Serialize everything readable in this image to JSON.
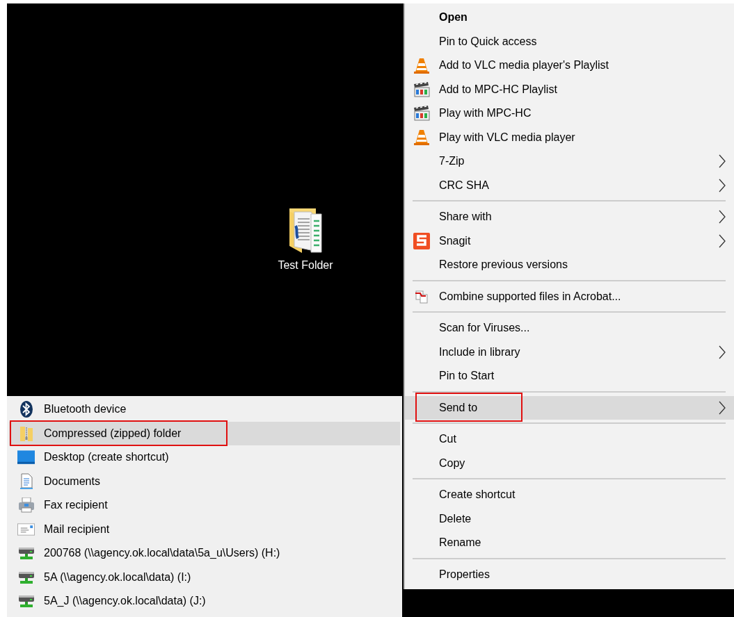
{
  "desktop": {
    "icons": [
      {
        "label": "Test Folder",
        "kind": "folder"
      }
    ]
  },
  "context_menu": {
    "groups": [
      {
        "items": [
          {
            "label": "Open",
            "kind": "plain",
            "default": true,
            "submenu": false,
            "selected": false,
            "outlined": false
          },
          {
            "label": "Pin to Quick access",
            "kind": "plain",
            "default": false,
            "submenu": false,
            "selected": false,
            "outlined": false
          },
          {
            "label": "Add to VLC media player's Playlist",
            "kind": "cone",
            "default": false,
            "submenu": false,
            "selected": false,
            "outlined": false
          },
          {
            "label": "Add to MPC-HC Playlist",
            "kind": "clapper",
            "default": false,
            "submenu": false,
            "selected": false,
            "outlined": false
          },
          {
            "label": "Play with MPC-HC",
            "kind": "clapper",
            "default": false,
            "submenu": false,
            "selected": false,
            "outlined": false
          },
          {
            "label": "Play with VLC media player",
            "kind": "cone",
            "default": false,
            "submenu": false,
            "selected": false,
            "outlined": false
          },
          {
            "label": "7-Zip",
            "kind": "plain",
            "default": false,
            "submenu": true,
            "selected": false,
            "outlined": false
          },
          {
            "label": "CRC SHA",
            "kind": "plain",
            "default": false,
            "submenu": true,
            "selected": false,
            "outlined": false
          }
        ]
      },
      {
        "items": [
          {
            "label": "Share with",
            "kind": "plain",
            "default": false,
            "submenu": true,
            "selected": false,
            "outlined": false
          },
          {
            "label": "Snagit",
            "kind": "snagit",
            "default": false,
            "submenu": true,
            "selected": false,
            "outlined": false
          },
          {
            "label": "Restore previous versions",
            "kind": "plain",
            "default": false,
            "submenu": false,
            "selected": false,
            "outlined": false
          }
        ]
      },
      {
        "items": [
          {
            "label": "Combine supported files in Acrobat...",
            "kind": "acrobat",
            "default": false,
            "submenu": false,
            "selected": false,
            "outlined": false
          }
        ]
      },
      {
        "items": [
          {
            "label": "Scan for Viruses...",
            "kind": "plain",
            "default": false,
            "submenu": false,
            "selected": false,
            "outlined": false
          },
          {
            "label": "Include in library",
            "kind": "plain",
            "default": false,
            "submenu": true,
            "selected": false,
            "outlined": false
          },
          {
            "label": "Pin to Start",
            "kind": "plain",
            "default": false,
            "submenu": false,
            "selected": false,
            "outlined": false
          }
        ]
      },
      {
        "items": [
          {
            "label": "Send to",
            "kind": "plain",
            "default": false,
            "submenu": true,
            "selected": true,
            "outlined": true
          }
        ]
      },
      {
        "items": [
          {
            "label": "Cut",
            "kind": "plain",
            "default": false,
            "submenu": false,
            "selected": false,
            "outlined": false
          },
          {
            "label": "Copy",
            "kind": "plain",
            "default": false,
            "submenu": false,
            "selected": false,
            "outlined": false
          }
        ]
      },
      {
        "items": [
          {
            "label": "Create shortcut",
            "kind": "plain",
            "default": false,
            "submenu": false,
            "selected": false,
            "outlined": false
          },
          {
            "label": "Delete",
            "kind": "plain",
            "default": false,
            "submenu": false,
            "selected": false,
            "outlined": false
          },
          {
            "label": "Rename",
            "kind": "plain",
            "default": false,
            "submenu": false,
            "selected": false,
            "outlined": false
          }
        ]
      },
      {
        "items": [
          {
            "label": "Properties",
            "kind": "plain",
            "default": false,
            "submenu": false,
            "selected": false,
            "outlined": false
          }
        ]
      }
    ]
  },
  "send_to_menu": {
    "items": [
      {
        "label": "Bluetooth device",
        "kind": "bluetooth",
        "selected": false,
        "outlined": false
      },
      {
        "label": "Compressed (zipped) folder",
        "kind": "zip",
        "selected": true,
        "outlined": true
      },
      {
        "label": "Desktop (create shortcut)",
        "kind": "desktop",
        "selected": false,
        "outlined": false
      },
      {
        "label": "Documents",
        "kind": "document",
        "selected": false,
        "outlined": false
      },
      {
        "label": "Fax recipient",
        "kind": "fax",
        "selected": false,
        "outlined": false
      },
      {
        "label": "Mail recipient",
        "kind": "mail",
        "selected": false,
        "outlined": false
      },
      {
        "label": "200768 (\\\\agency.ok.local\\data\\5a_u\\Users) (H:)",
        "kind": "drive",
        "selected": false,
        "outlined": false
      },
      {
        "label": "5A (\\\\agency.ok.local\\data) (I:)",
        "kind": "drive",
        "selected": false,
        "outlined": false
      },
      {
        "label": "5A_J (\\\\agency.ok.local\\data) (J:)",
        "kind": "drive",
        "selected": false,
        "outlined": false
      }
    ]
  }
}
